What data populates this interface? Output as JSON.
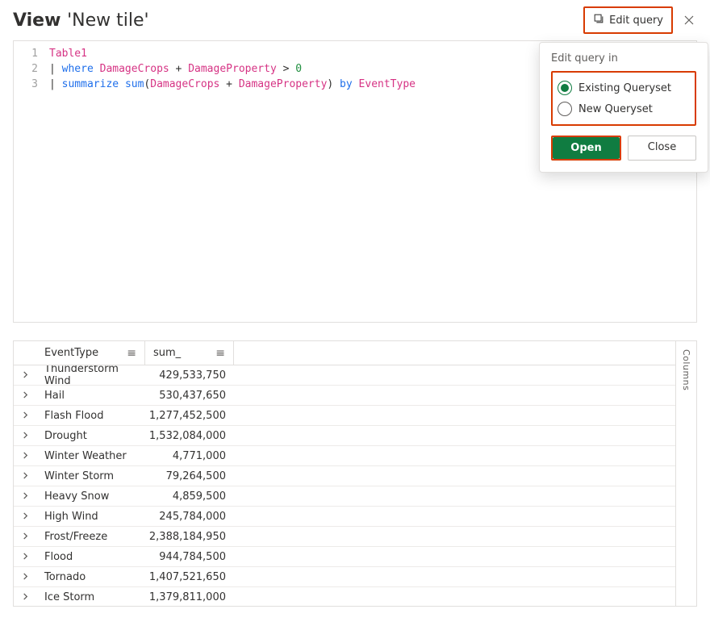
{
  "header": {
    "view_label": "View",
    "tile_name": "'New tile'",
    "edit_query_label": "Edit query"
  },
  "popover": {
    "title": "Edit query in",
    "options": [
      {
        "label": "Existing Queryset",
        "checked": true
      },
      {
        "label": "New Queryset",
        "checked": false
      }
    ],
    "open_label": "Open",
    "close_label": "Close"
  },
  "editor": {
    "lines": [
      {
        "num": "1"
      },
      {
        "num": "2"
      },
      {
        "num": "3"
      }
    ],
    "tokens": {
      "table": "Table1",
      "pipe": "| ",
      "where": "where",
      "summarize": "summarize",
      "sum": "sum",
      "lp": "(",
      "rp": ")",
      "gt": " > ",
      "plus": " + ",
      "zero": "0",
      "by": " by ",
      "DamageCrops": "DamageCrops",
      "DamageProperty": "DamageProperty",
      "EventType": "EventType"
    }
  },
  "results": {
    "columns": {
      "event": "EventType",
      "sum": "sum_"
    },
    "columns_tab": "Columns",
    "rows": [
      {
        "event": "Thunderstorm Wind",
        "sum": "429,533,750"
      },
      {
        "event": "Hail",
        "sum": "530,437,650"
      },
      {
        "event": "Flash Flood",
        "sum": "1,277,452,500"
      },
      {
        "event": "Drought",
        "sum": "1,532,084,000"
      },
      {
        "event": "Winter Weather",
        "sum": "4,771,000"
      },
      {
        "event": "Winter Storm",
        "sum": "79,264,500"
      },
      {
        "event": "Heavy Snow",
        "sum": "4,859,500"
      },
      {
        "event": "High Wind",
        "sum": "245,784,000"
      },
      {
        "event": "Frost/Freeze",
        "sum": "2,388,184,950"
      },
      {
        "event": "Flood",
        "sum": "944,784,500"
      },
      {
        "event": "Tornado",
        "sum": "1,407,521,650"
      },
      {
        "event": "Ice Storm",
        "sum": "1,379,811,000"
      }
    ]
  }
}
